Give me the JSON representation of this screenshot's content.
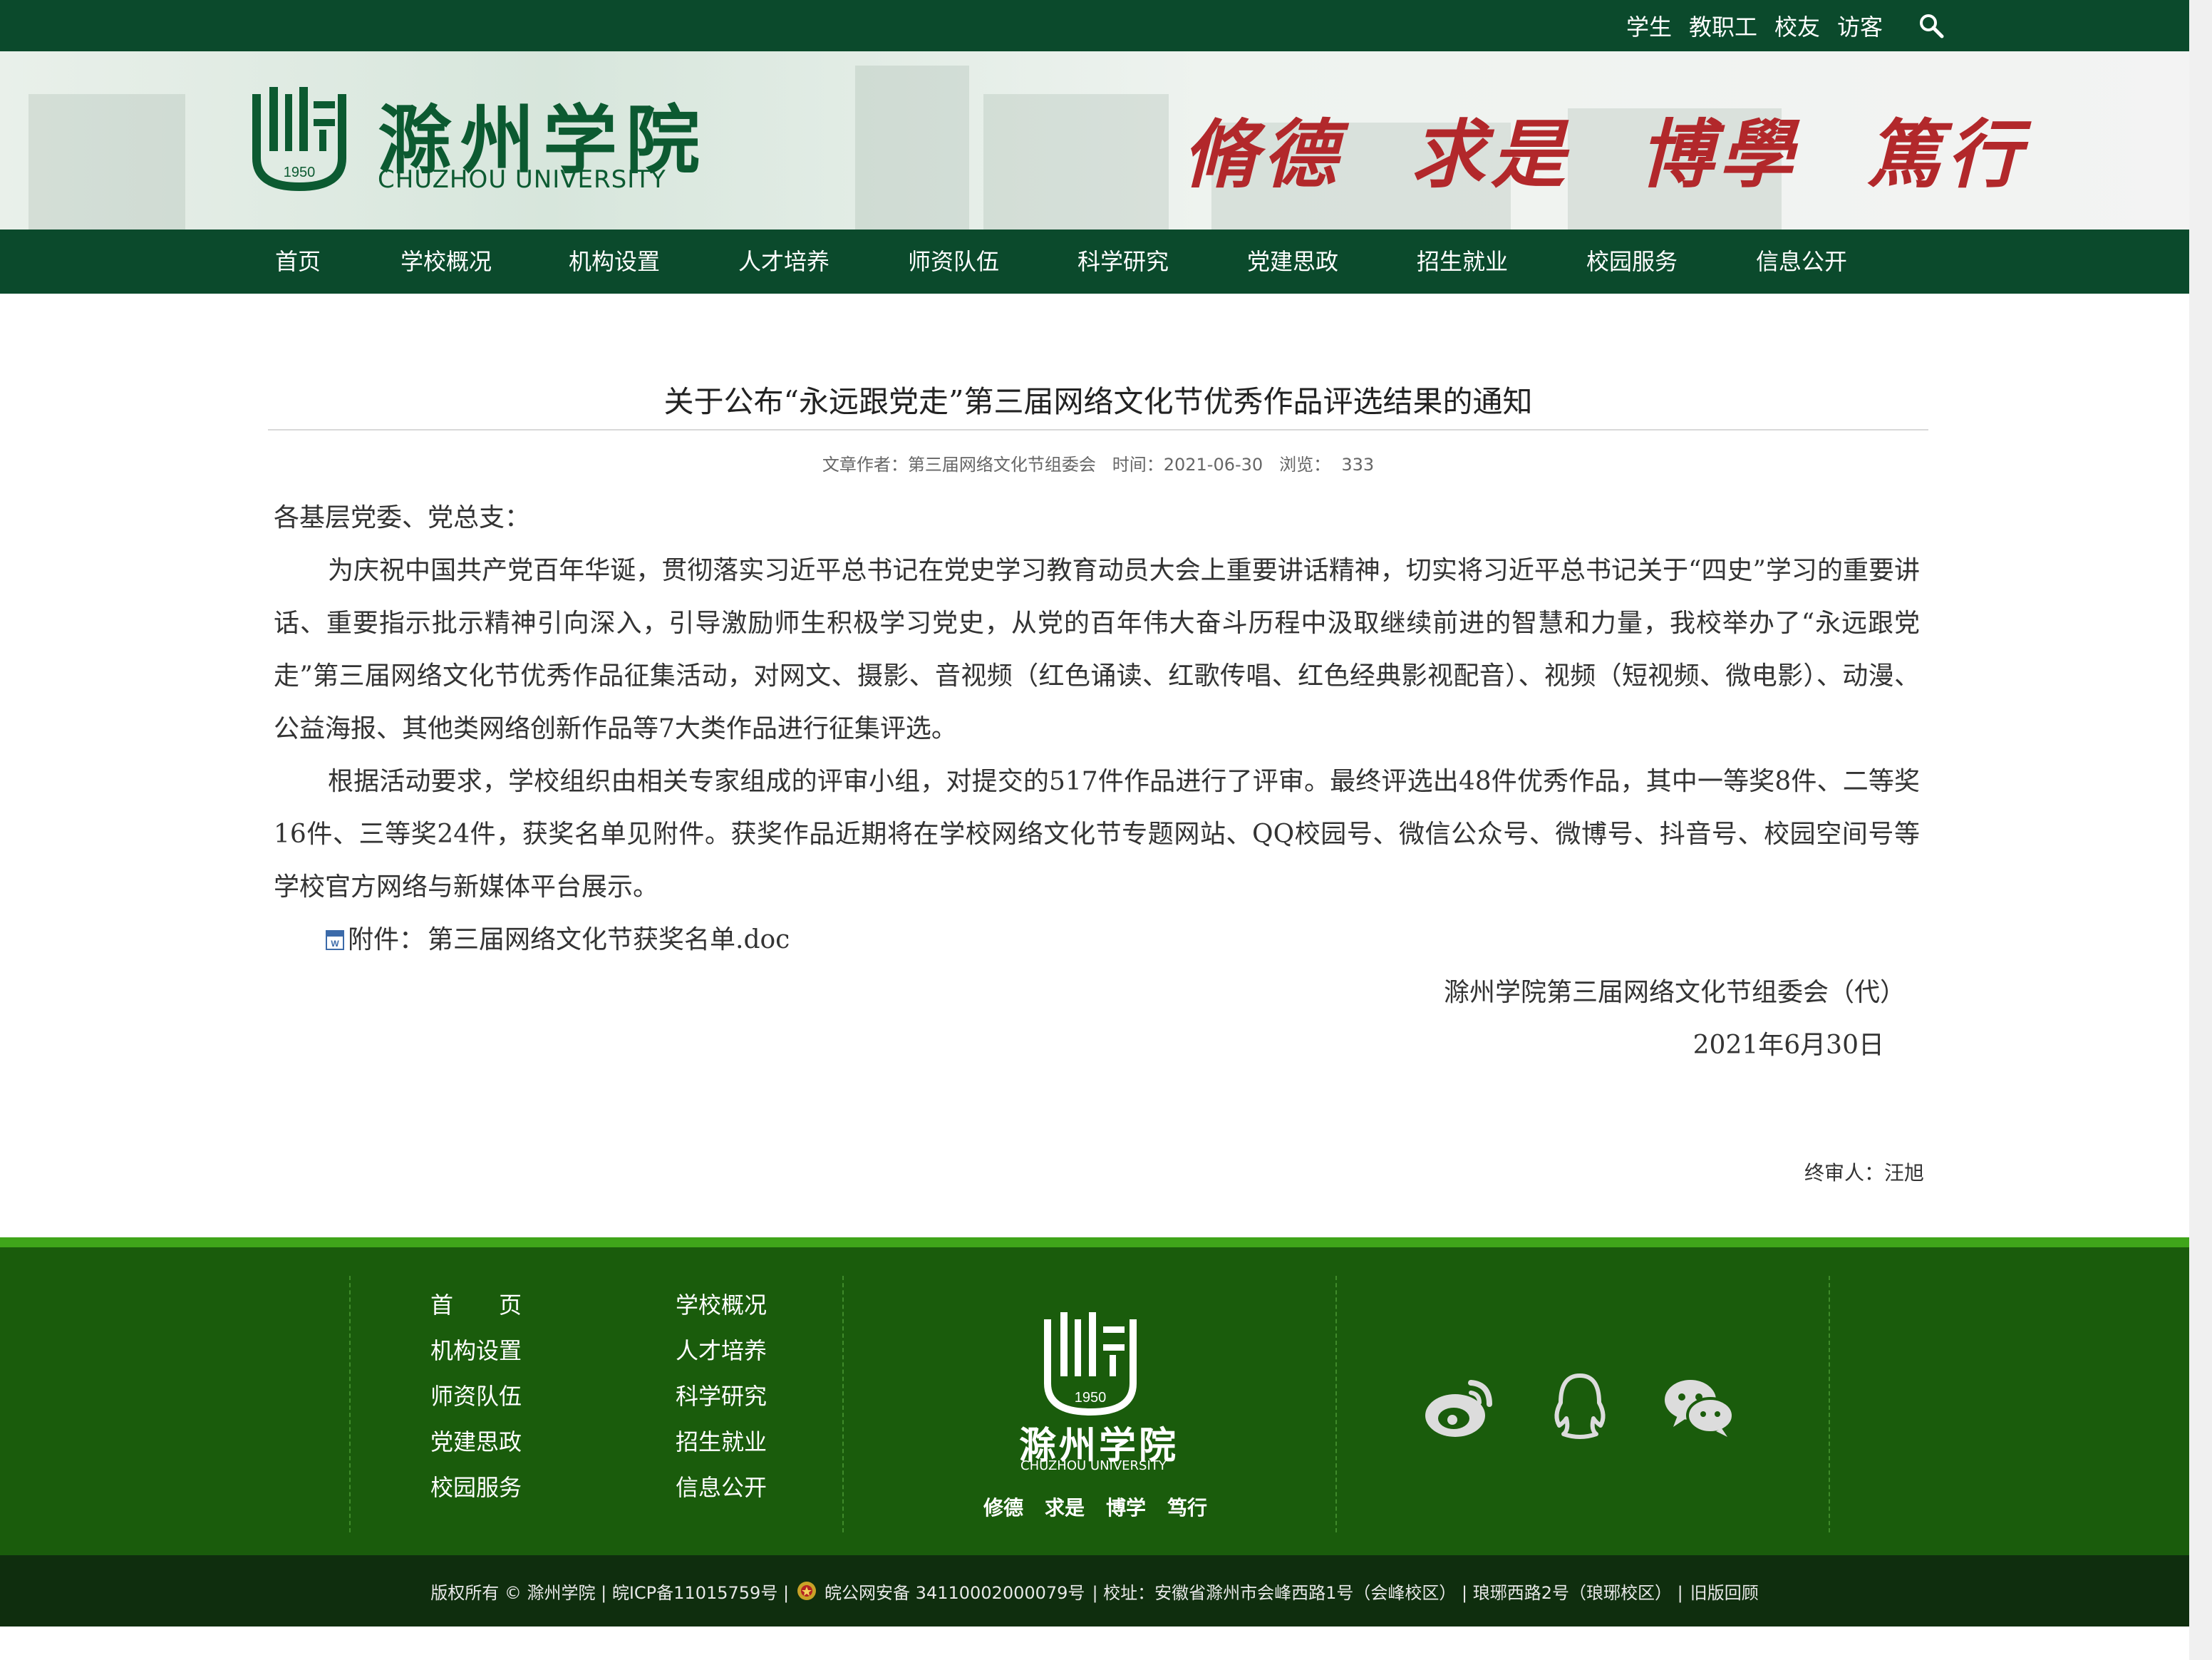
{
  "topbar": {
    "links": [
      "学生",
      "教职工",
      "校友",
      "访客"
    ],
    "search_icon": "search-icon"
  },
  "brand": {
    "name_cn": "滁州学院",
    "name_en": "CHUZHOU UNIVERSITY",
    "logo_year": "1950",
    "motto": [
      "脩德",
      "求是",
      "博學",
      "篤行"
    ],
    "colors": {
      "primary": "#0b4a2c",
      "accent": "#b2282b",
      "footer": "#1a5c0c"
    }
  },
  "nav": {
    "items": [
      "首页",
      "学校概况",
      "机构设置",
      "人才培养",
      "师资队伍",
      "科学研究",
      "党建思政",
      "招生就业",
      "校园服务",
      "信息公开"
    ]
  },
  "article": {
    "title": "关于公布“永远跟党走”第三届网络文化节优秀作品评选结果的通知",
    "meta": {
      "author_label": "文章作者：",
      "author": "第三届网络文化节组委会",
      "time_label": "时间：",
      "time": "2021-06-30",
      "views_label": "浏览：",
      "views": "333"
    },
    "salutation": "各基层党委、党总支：",
    "paragraph1": "为庆祝中国共产党百年华诞，贯彻落实习近平总书记在党史学习教育动员大会上重要讲话精神，切实将习近平总书记关于“四史”学习的重要讲话、重要指示批示精神引向深入，引导激励师生积极学习党史，从党的百年伟大奋斗历程中汲取继续前进的智慧和力量，我校举办了“永远跟党走”第三届网络文化节优秀作品征集活动，对网文、摄影、音视频（红色诵读、红歌传唱、红色经典影视配音）、视频（短视频、微电影）、动漫、公益海报、其他类网络创新作品等7大类作品进行征集评选。",
    "paragraph2": "根据活动要求，学校组织由相关专家组成的评审小组，对提交的517件作品进行了评审。最终评选出48件优秀作品，其中一等奖8件、二等奖16件、三等奖24件，获奖名单见附件。获奖作品近期将在学校网络文化节专题网站、QQ校园号、微信公众号、微博号、抖音号、校园空间号等学校官方网络与新媒体平台展示。",
    "attachment_label": "附件：",
    "attachment_file": "第三届网络文化节获奖名单.doc",
    "signature": "滁州学院第三届网络文化节组委会（代）",
    "date": "2021年6月30日",
    "reviewer": "终审人：汪旭"
  },
  "footer": {
    "links_col1": [
      "首　　页",
      "机构设置",
      "师资队伍",
      "党建思政",
      "校园服务"
    ],
    "links_col2": [
      "学校概况",
      "人才培养",
      "科学研究",
      "招生就业",
      "信息公开"
    ],
    "logo_name_cn": "滁州学院",
    "logo_name_en": "CHUZHOU UNIVERSITY",
    "logo_year": "1950",
    "motto": [
      "修德",
      "求是",
      "博学",
      "笃行"
    ],
    "social_icons": [
      "weibo-icon",
      "qq-icon",
      "wechat-icon"
    ]
  },
  "bottombar": {
    "copyright": "版权所有 © 滁州学院 | 皖ICP备11015759号 |",
    "police": "皖公网安备 34110002000079号",
    "address": "| 校址：安徽省滁州市会峰西路1号（会峰校区） | 琅琊西路2号（琅琊校区） |",
    "old_version": "旧版回顾"
  }
}
